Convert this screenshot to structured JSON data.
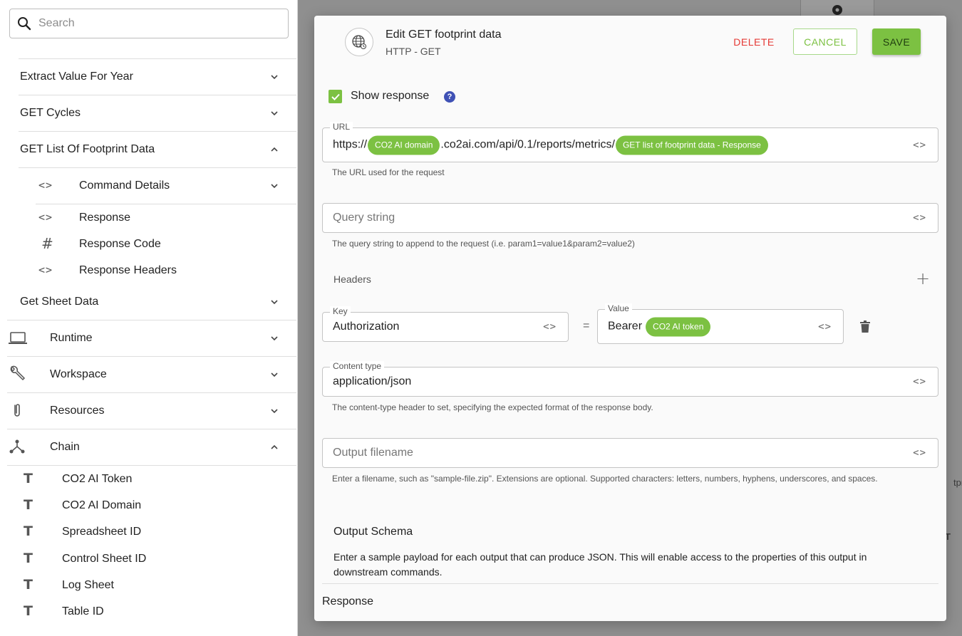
{
  "sidebar": {
    "search_placeholder": "Search",
    "sections": [
      {
        "label": "Extract Value For Year"
      },
      {
        "label": "GET Cycles"
      },
      {
        "label": "GET List Of Footprint Data"
      },
      {
        "label": "Get Sheet Data"
      }
    ],
    "sub_items": [
      {
        "label": "Command Details",
        "icon": "code-icon",
        "glyph": "<>"
      },
      {
        "label": "Response",
        "icon": "code-icon",
        "glyph": "<>"
      },
      {
        "label": "Response Code",
        "icon": "hash-icon",
        "glyph": "#"
      },
      {
        "label": "Response Headers",
        "icon": "code-icon",
        "glyph": "<>"
      }
    ],
    "groups": [
      {
        "label": "Runtime",
        "icon": "laptop-icon"
      },
      {
        "label": "Workspace",
        "icon": "wrench-icon"
      },
      {
        "label": "Resources",
        "icon": "paperclip-icon"
      },
      {
        "label": "Chain",
        "icon": "chain-icon"
      }
    ],
    "chain_items": [
      {
        "label": "CO2 AI Token",
        "glyph": "T"
      },
      {
        "label": "CO2 AI Domain",
        "glyph": "T"
      },
      {
        "label": "Spreadsheet ID",
        "glyph": "T"
      },
      {
        "label": "Control Sheet ID",
        "glyph": "T"
      },
      {
        "label": "Log Sheet",
        "glyph": "T"
      },
      {
        "label": "Table ID",
        "glyph": "T"
      }
    ]
  },
  "modal": {
    "title": "Edit GET footprint data",
    "subtitle": "HTTP - GET",
    "delete_label": "DELETE",
    "cancel_label": "CANCEL",
    "save_label": "SAVE",
    "show_response_label": "Show response",
    "show_response_checked": true,
    "help_glyph": "?",
    "code_glyph": "<>",
    "url": {
      "label": "URL",
      "prefix": "https://",
      "chip1": "CO2 AI domain",
      "middle": ".co2ai.com/api/0.1/reports/metrics/",
      "chip2": "GET list of footprint data - Response",
      "helper": "The URL used for the request"
    },
    "query": {
      "placeholder": "Query string",
      "helper": "The query string to append to the request (i.e. param1=value1&param2=value2)"
    },
    "headers": {
      "label": "Headers",
      "add_glyph": "+",
      "key_label": "Key",
      "key_value": "Authorization",
      "equals": "=",
      "value_label": "Value",
      "value_prefix": "Bearer",
      "value_chip": "CO2 AI token"
    },
    "content_type": {
      "label": "Content type",
      "value": "application/json",
      "helper": "The content-type header to set, specifying the expected format of the response body."
    },
    "output_filename": {
      "placeholder": "Output filename",
      "helper": "Enter a filename, such as \"sample-file.zip\". Extensions are optional. Supported characters: letters, numbers, hyphens, underscores, and spaces."
    },
    "output_schema": {
      "title": "Output Schema",
      "description": "Enter a sample payload for each output that can produce JSON. This will enable access to the properties of this output in downstream commands."
    },
    "response_label": "Response"
  },
  "background": {
    "fragment1": "tprin",
    "fragment2": "T"
  },
  "colors": {
    "accent_green": "#7cc142",
    "danger_red": "#e53935",
    "help_blue": "#3f51b5"
  }
}
